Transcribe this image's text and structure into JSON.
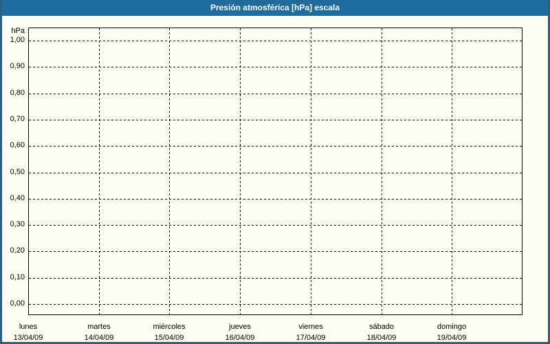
{
  "window": {
    "title": "Presión atmosférica [hPa] escala"
  },
  "chart_data": {
    "type": "line",
    "title": "Presión atmosférica [hPa] escala",
    "ylabel": "hPa",
    "xlabel": "",
    "ylim": [
      0.0,
      1.0
    ],
    "y_tick_step": 0.1,
    "y_ticks": [
      "1,00",
      "0,90",
      "0,80",
      "0,70",
      "0,60",
      "0,50",
      "0,40",
      "0,30",
      "0,20",
      "0,10",
      "0,00"
    ],
    "x_categories": [
      {
        "day": "lunes",
        "date": "13/04/09"
      },
      {
        "day": "martes",
        "date": "14/04/09"
      },
      {
        "day": "miércoles",
        "date": "15/04/09"
      },
      {
        "day": "jueves",
        "date": "16/04/09"
      },
      {
        "day": "viernes",
        "date": "17/04/09"
      },
      {
        "day": "sábado",
        "date": "18/04/09"
      },
      {
        "day": "domingo",
        "date": "19/04/09"
      }
    ],
    "series": [],
    "grid": "dashed",
    "legend": "none"
  },
  "colors": {
    "titlebar_bg": "#1F6B9D",
    "frame_border": "#2A5F86",
    "page_bg": "#FBFCF2",
    "grid_line": "#000000",
    "title_text": "#FFFFFF",
    "label_text": "#000000"
  }
}
